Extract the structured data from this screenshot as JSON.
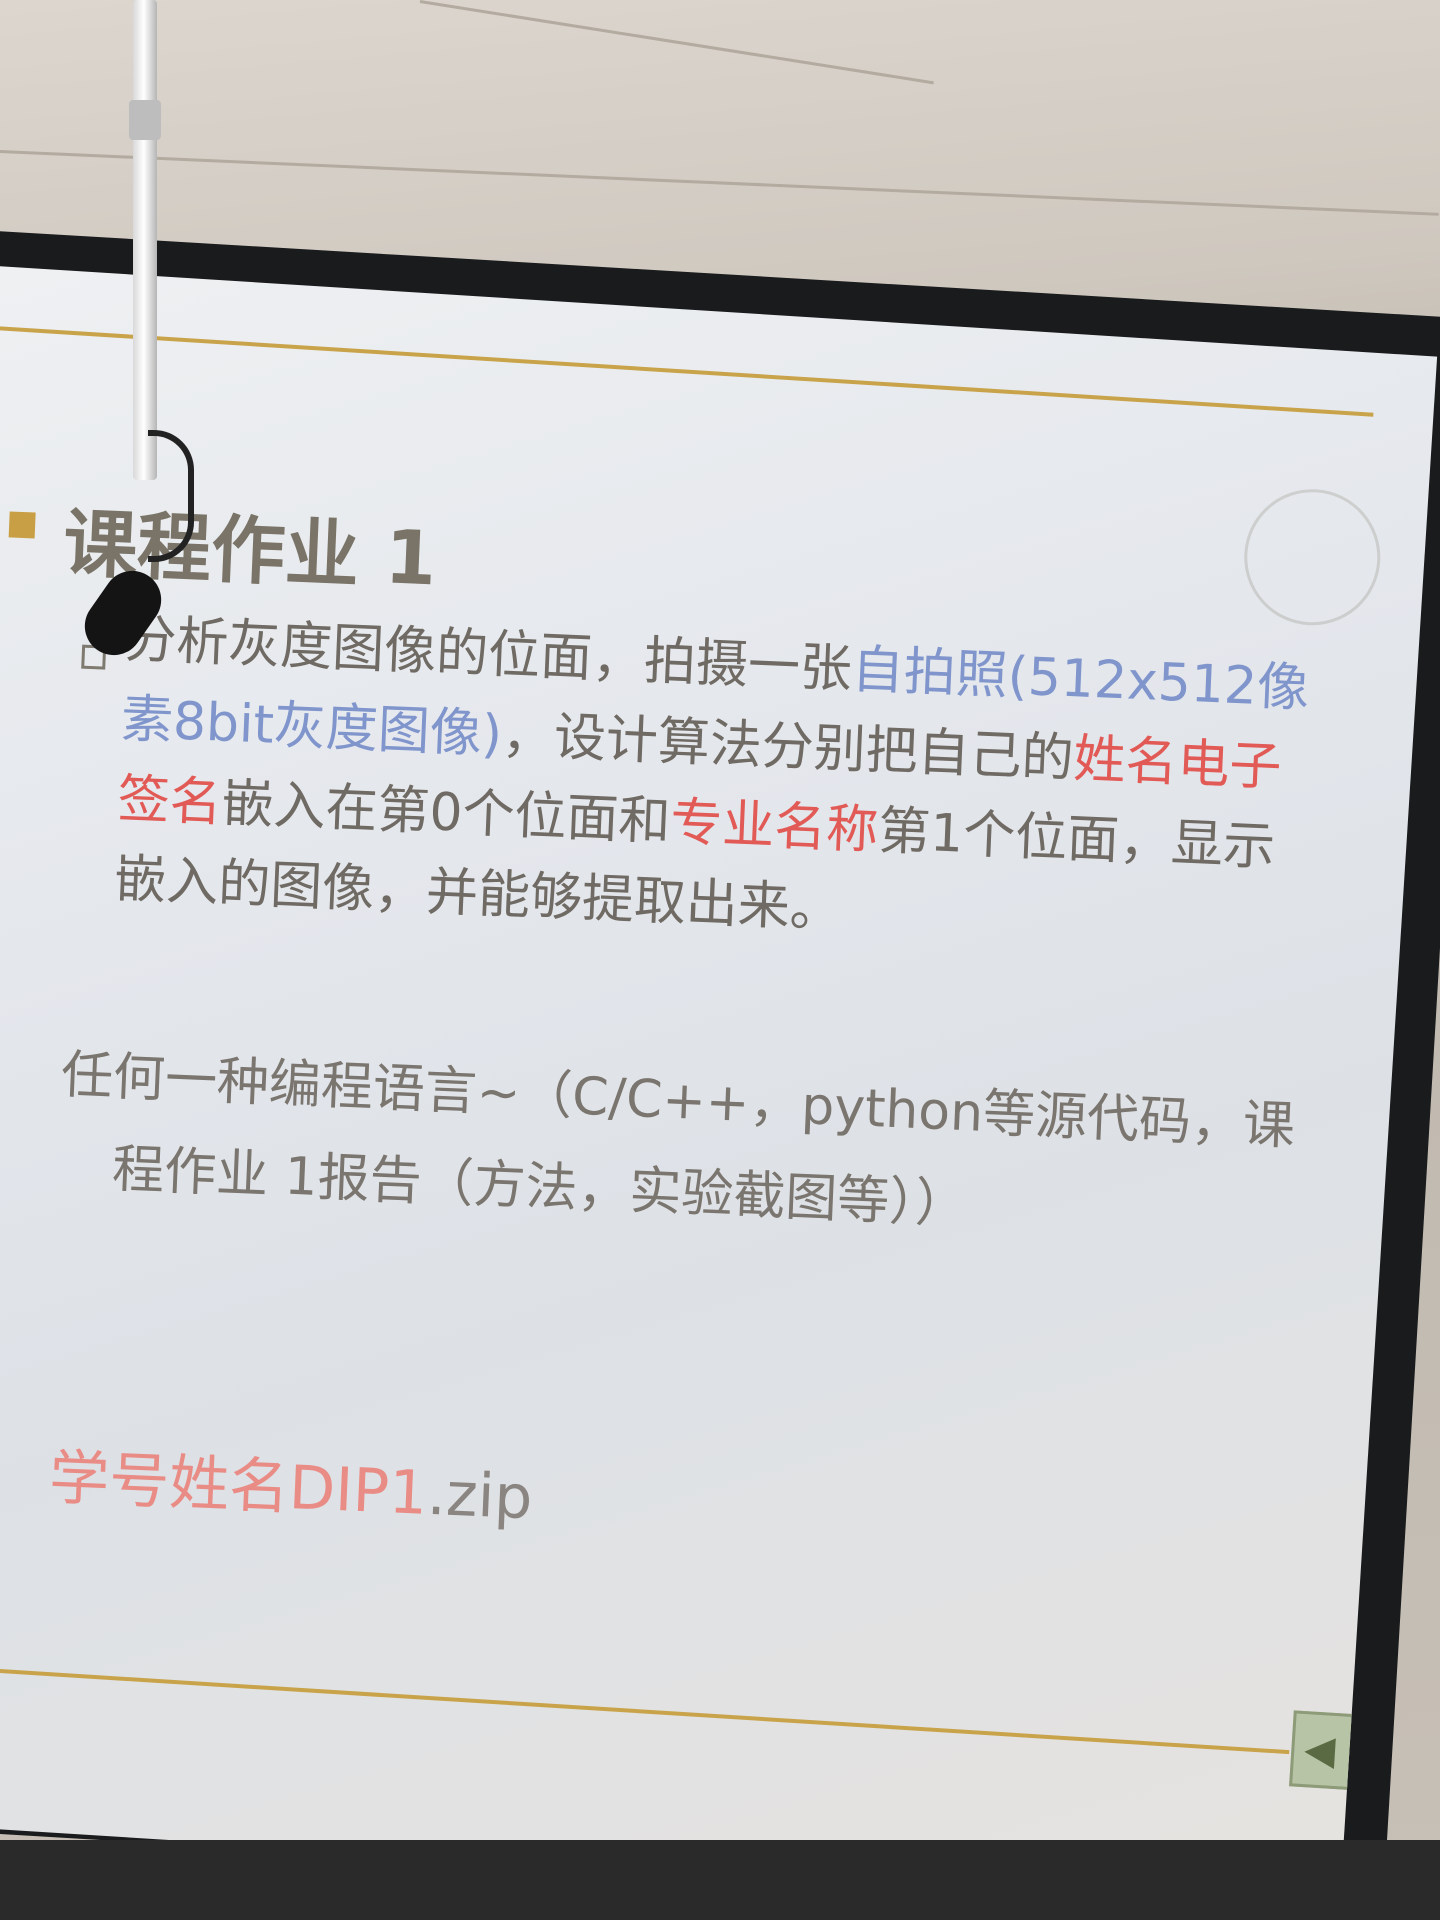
{
  "slide": {
    "title": "课程作业 1",
    "task": {
      "line1_a": "分析灰度图像的位面，拍摄一张",
      "line1_b": "自拍照(512x512像",
      "line2_a": "素8bit灰度图像)",
      "line2_b": "，设计算法分别把自己的",
      "line2_c": "姓名电子",
      "line3_a": "签名",
      "line3_b": "嵌入在第0个位面和",
      "line3_c": "专业名称",
      "line3_d": "第1个位面，显示",
      "line4": "嵌入的图像，并能够提取出来。"
    },
    "language_note": {
      "line1": "任何一种编程语言~（C/C++，python等源代码，课",
      "line2": "程作业 1报告（方法，实验截图等））"
    },
    "submission": {
      "name_red": "学号姓名DIP1",
      "ext": ".zip"
    },
    "nav_arrow_glyph": "◀"
  },
  "colors": {
    "accent_rule": "#c9a34a",
    "highlight_blue": "#7f95cc",
    "highlight_red": "#e25a56",
    "body_text": "#6f6a63"
  }
}
